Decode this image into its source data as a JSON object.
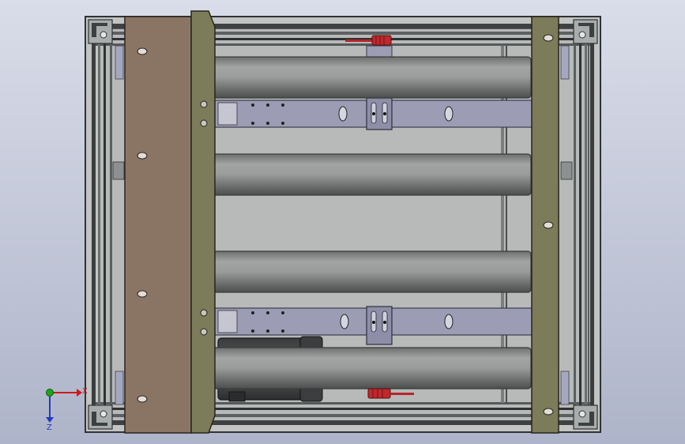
{
  "viewport": {
    "bg_top": "#d9dde9",
    "bg_bottom": "#aeb4c9"
  },
  "triad": {
    "x_label": "X",
    "z_label": "Z",
    "x_color": "#d01818",
    "y_color": "#1aa61a",
    "z_color": "#1f3bc4"
  },
  "colors": {
    "plate_brown": "#8a7565",
    "plate_olive": "#7c7b5a",
    "frame": "#3b3f3f",
    "frame_light": "#9aa0a2",
    "roller_mid": "#8a8c8c",
    "crossbar": "#9c9cb4",
    "handle_red": "#b3262a"
  }
}
